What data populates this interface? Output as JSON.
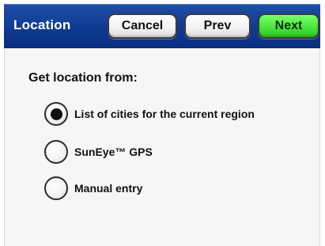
{
  "header": {
    "title": "Location",
    "buttons": {
      "cancel": "Cancel",
      "prev": "Prev",
      "next": "Next"
    },
    "colors": {
      "bar": "#0f3a92",
      "next_button": "#46e83c"
    }
  },
  "main": {
    "prompt": "Get location from:",
    "options": [
      {
        "label": "List of cities for the current region",
        "selected": true
      },
      {
        "label": "SunEye™ GPS",
        "selected": false
      },
      {
        "label": "Manual entry",
        "selected": false
      }
    ]
  }
}
